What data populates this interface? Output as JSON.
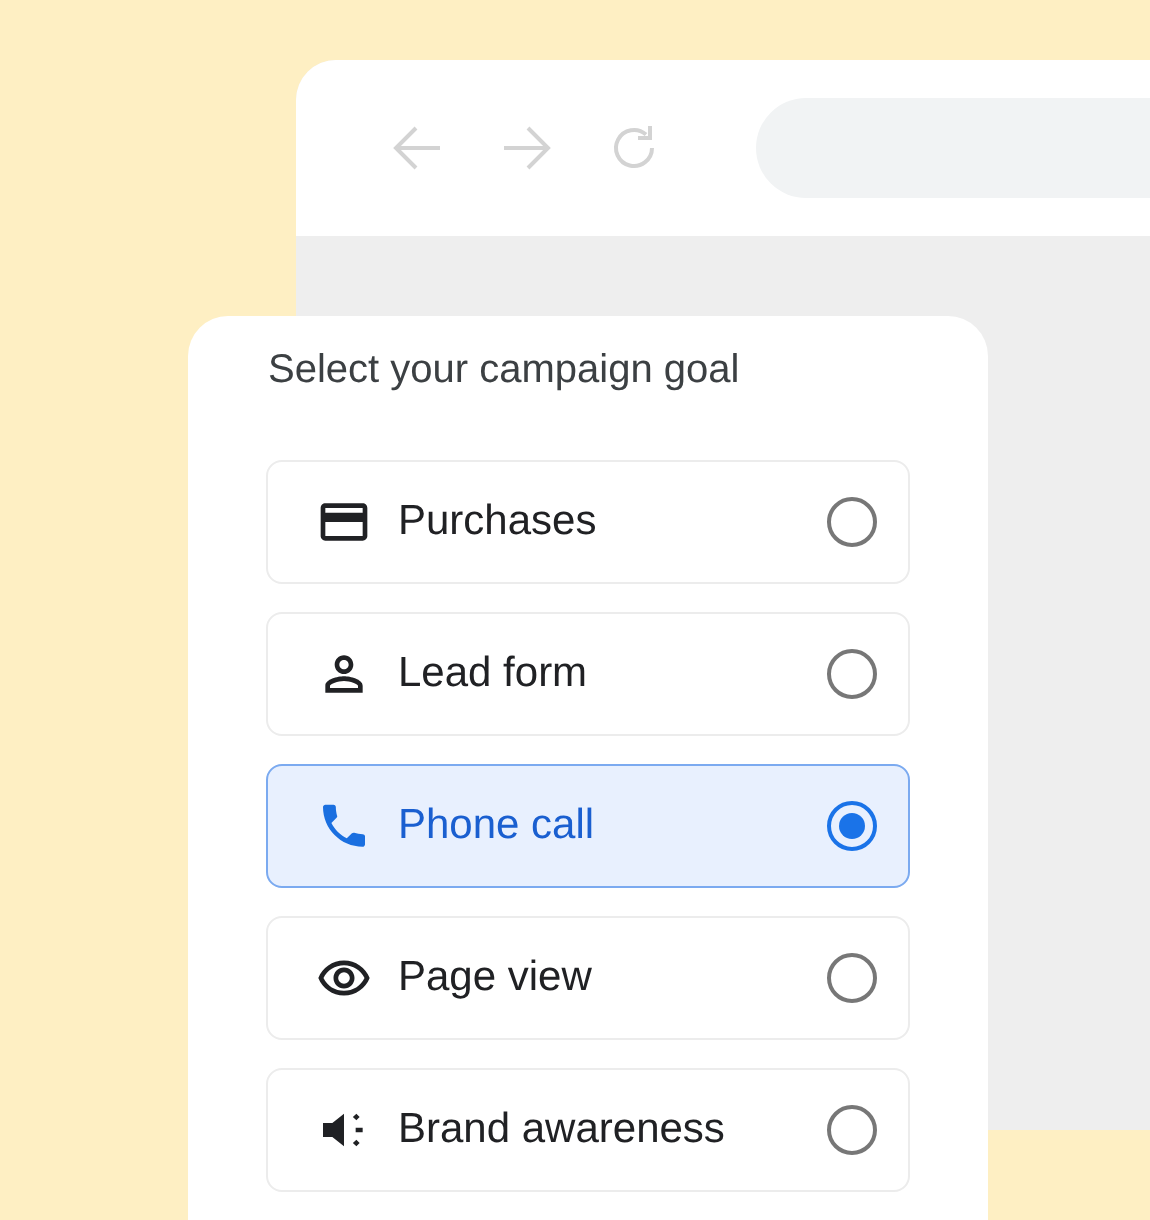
{
  "card": {
    "title": "Select your campaign goal",
    "options": [
      {
        "kind": "card",
        "label": "Purchases",
        "selected": false
      },
      {
        "kind": "person",
        "label": "Lead form",
        "selected": false
      },
      {
        "kind": "phone",
        "label": "Phone call",
        "selected": true
      },
      {
        "kind": "eye",
        "label": "Page view",
        "selected": false
      },
      {
        "kind": "megaphone",
        "label": "Brand awareness",
        "selected": false
      }
    ]
  }
}
